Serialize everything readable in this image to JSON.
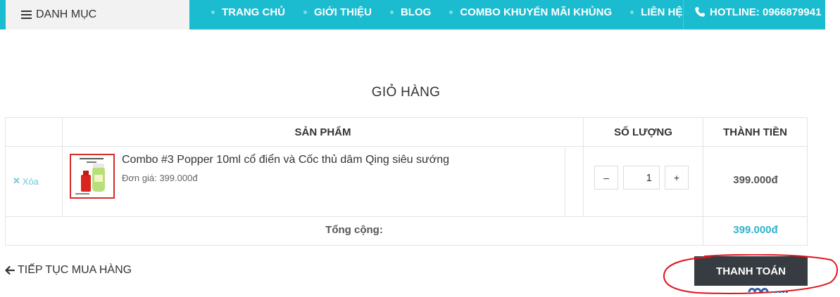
{
  "nav": {
    "menu_label": "DANH MỤC",
    "items": [
      {
        "label": "TRANG CHỦ"
      },
      {
        "label": "GIỚI THIỆU"
      },
      {
        "label": "BLOG"
      },
      {
        "label": "COMBO KHUYẾN MÃI KHỦNG"
      },
      {
        "label": "LIÊN HỆ"
      }
    ],
    "hotline": "HOTLINE: 0966879941"
  },
  "cart": {
    "title": "GIỎ HÀNG",
    "headers": {
      "product": "SẢN PHẨM",
      "quantity": "SỐ LƯỢNG",
      "total": "THÀNH TIỀN"
    },
    "items": [
      {
        "remove_label": "Xóa",
        "name": "Combo #3 Popper 10ml cổ điển và Cốc thủ dâm Qing siêu sướng",
        "unit_price": "Đơn giá: 399.000đ",
        "quantity": "1",
        "line_total": "399.000đ"
      }
    ],
    "qty_minus": "–",
    "qty_plus": "+",
    "total_label": "Tổng cộng:",
    "total_value": "399.000đ"
  },
  "actions": {
    "continue_label": "TIẾP TỤC MUA HÀNG",
    "checkout_label": "THANH TOÁN"
  },
  "colors": {
    "nav_bg": "#1bbccf",
    "checkout_bg": "#373c42",
    "accent": "#2eb3c9",
    "annotation_circle": "#e0141e"
  }
}
